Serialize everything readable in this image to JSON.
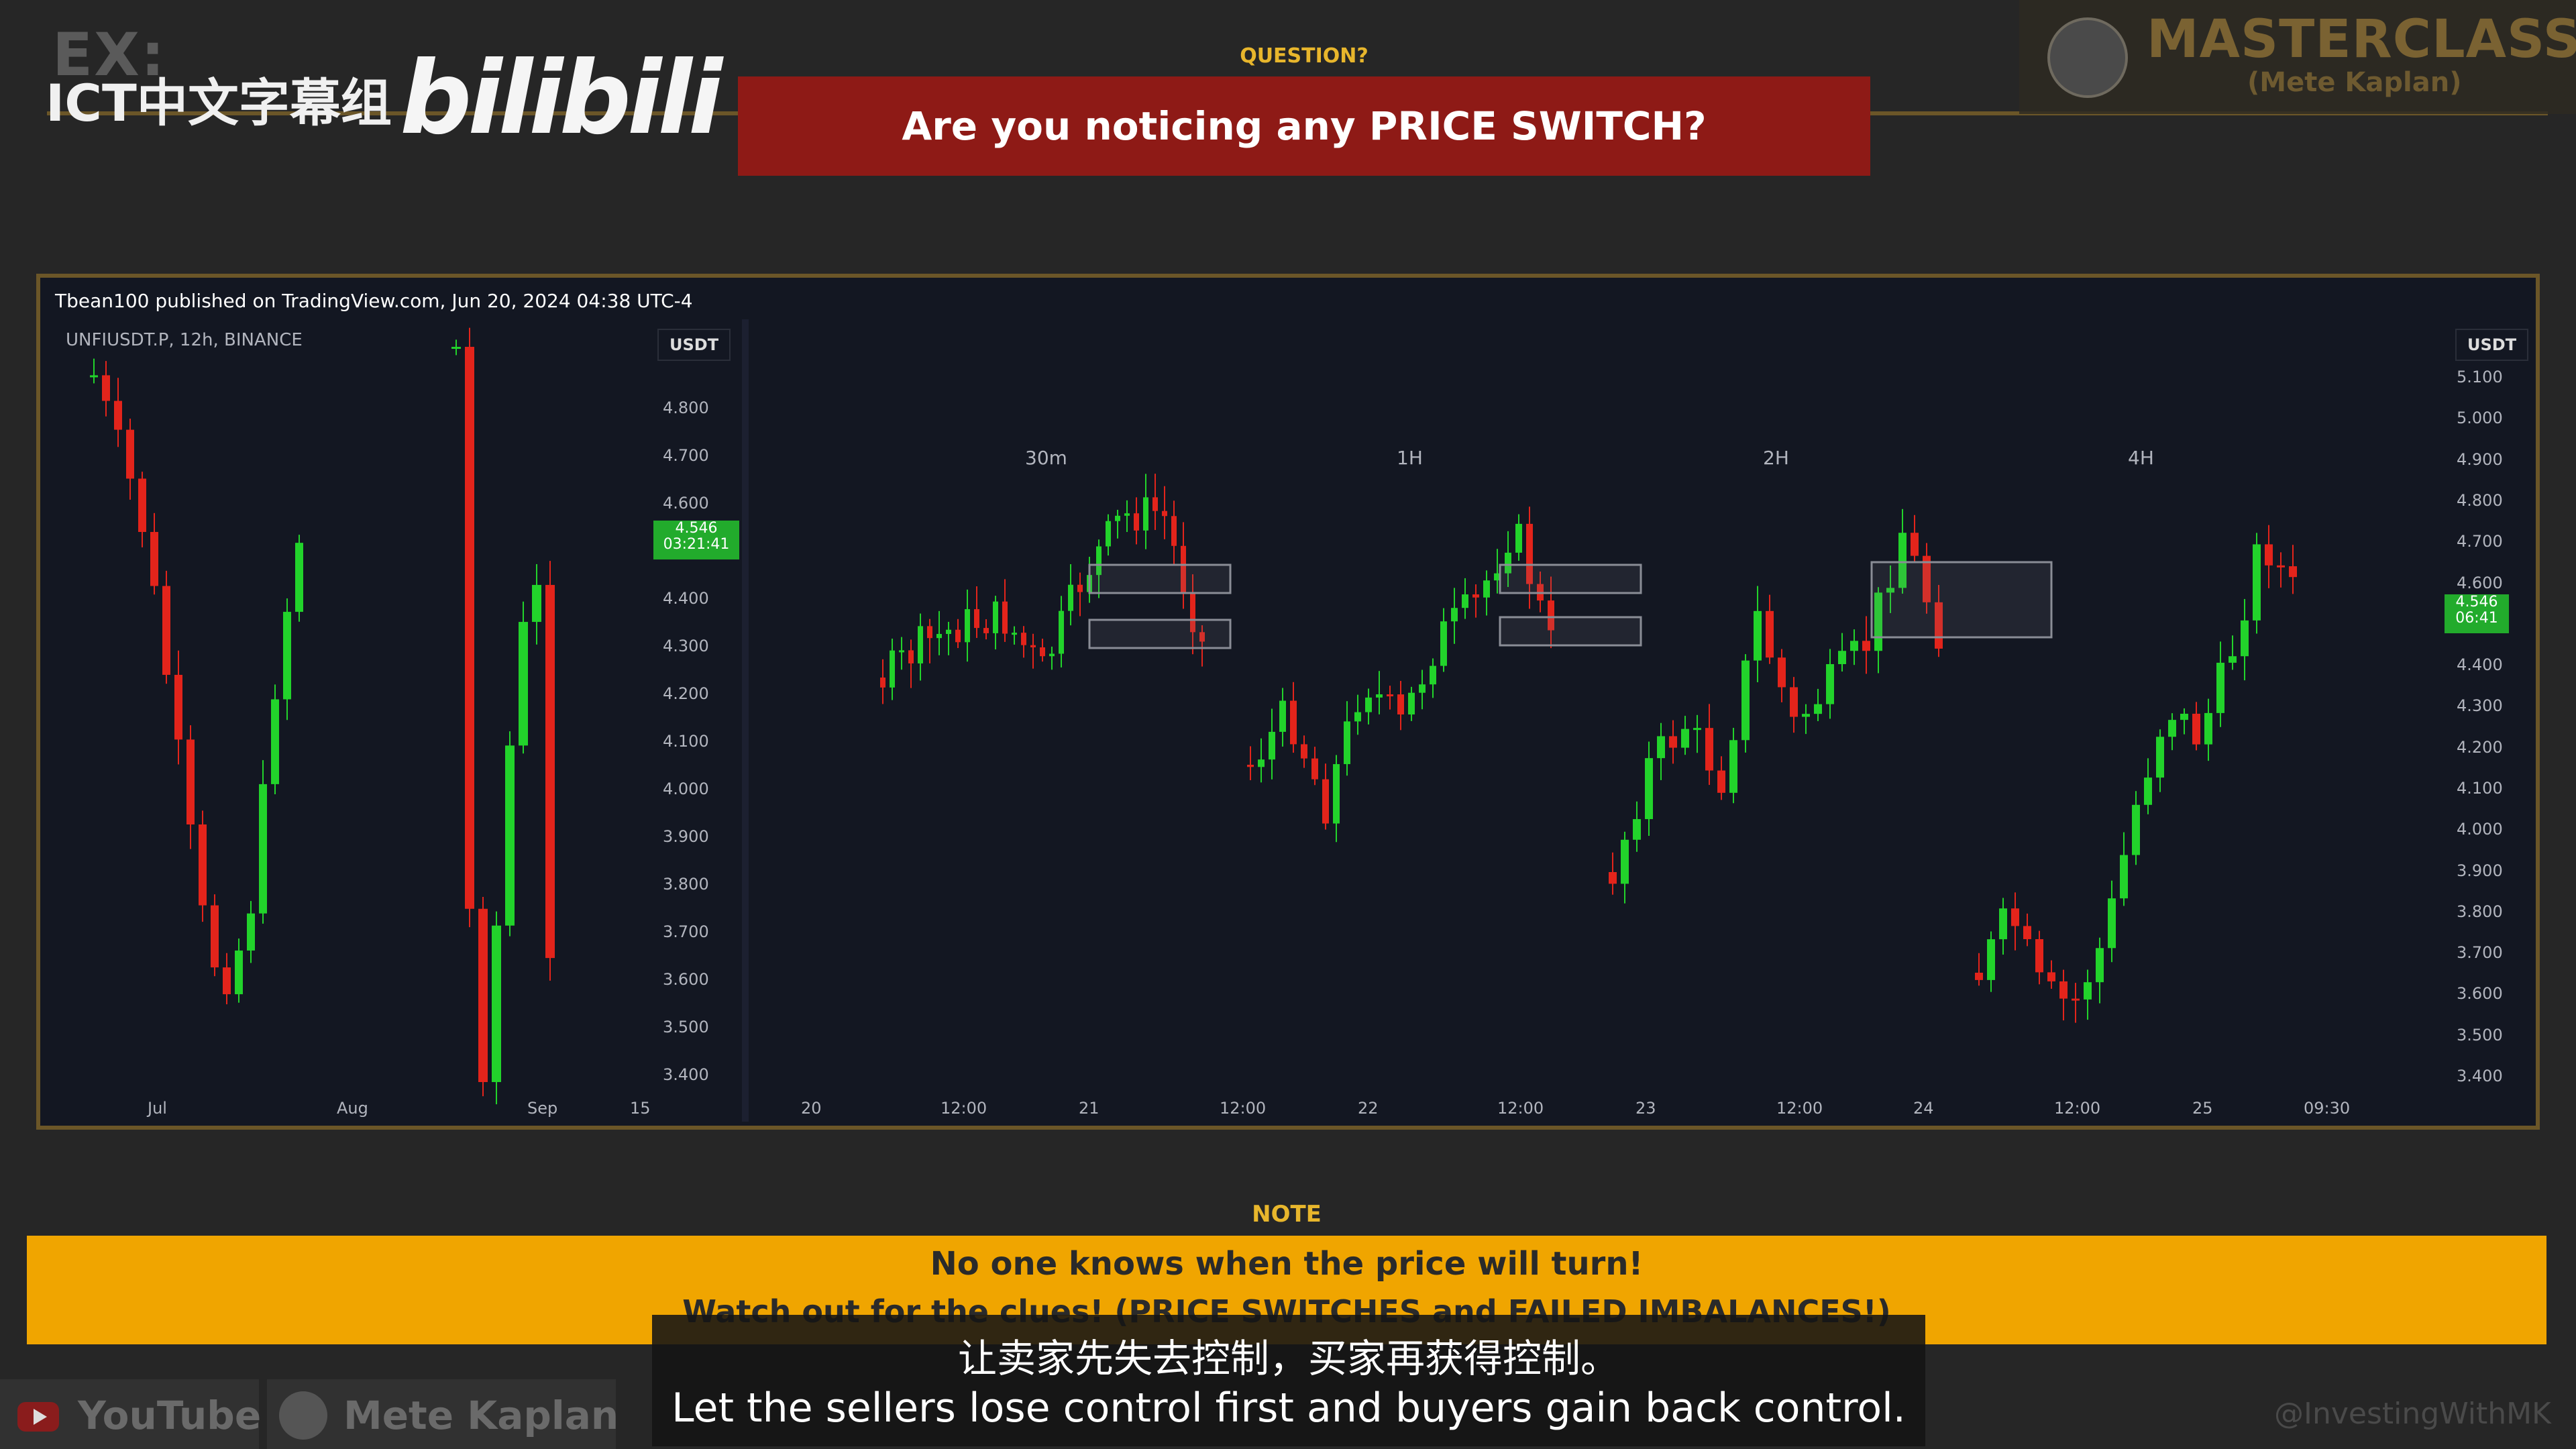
{
  "header": {
    "watermark_ex": "EX:",
    "watermark_group": "ICT中文字幕组",
    "watermark_site": "bilibili",
    "question_label": "QUESTION?",
    "question_text": "Are you noticing any PRICE SWITCH?",
    "masterclass_title": "MASTERCLASS",
    "masterclass_sub": "(Mete Kaplan)"
  },
  "chart": {
    "publish_line": "Tbean100 published on TradingView.com, Jun 20, 2024 04:38 UTC-4",
    "left_symbol": "UNFIUSDT.P, 12h, BINANCE",
    "currency": "USDT",
    "left_price_tag": "4.546",
    "left_price_timer": "03:21:41",
    "right_price_tag": "4.546",
    "right_price_timer": "06:41",
    "left_y_ticks": [
      "4.800",
      "4.700",
      "4.600",
      "4.400",
      "4.300",
      "4.200",
      "4.100",
      "4.000",
      "3.900",
      "3.800",
      "3.700",
      "3.600",
      "3.500",
      "3.400"
    ],
    "right_y_ticks": [
      "5.100",
      "5.000",
      "4.900",
      "4.800",
      "4.700",
      "4.600",
      "4.400",
      "4.300",
      "4.200",
      "4.100",
      "4.000",
      "3.900",
      "3.800",
      "3.700",
      "3.600",
      "3.500",
      "3.400"
    ],
    "left_x_ticks": [
      "Jul",
      "Aug",
      "Sep",
      "15"
    ],
    "right_x_ticks": [
      "20",
      "12:00",
      "21",
      "12:00",
      "22",
      "12:00",
      "23",
      "12:00",
      "24",
      "12:00",
      "25",
      "09:30"
    ],
    "timeframes": [
      "30m",
      "1H",
      "2H",
      "4H"
    ],
    "colors": {
      "up": "#22d32b",
      "down": "#e3241b",
      "background": "#131722"
    }
  },
  "note": {
    "label": "NOTE",
    "line1": "No one knows when the price will turn!",
    "line2": "Watch out for the clues! (PRICE SWITCHES and FAILED IMBALANCES!)"
  },
  "subtitle": {
    "cn": "让卖家先失去控制，买家再获得控制。",
    "en": "Let the sellers lose control first and buyers gain back control."
  },
  "footer": {
    "youtube": "YouTube",
    "author": "Mete Kaplan",
    "handle": "@InvestingWithMK"
  }
}
